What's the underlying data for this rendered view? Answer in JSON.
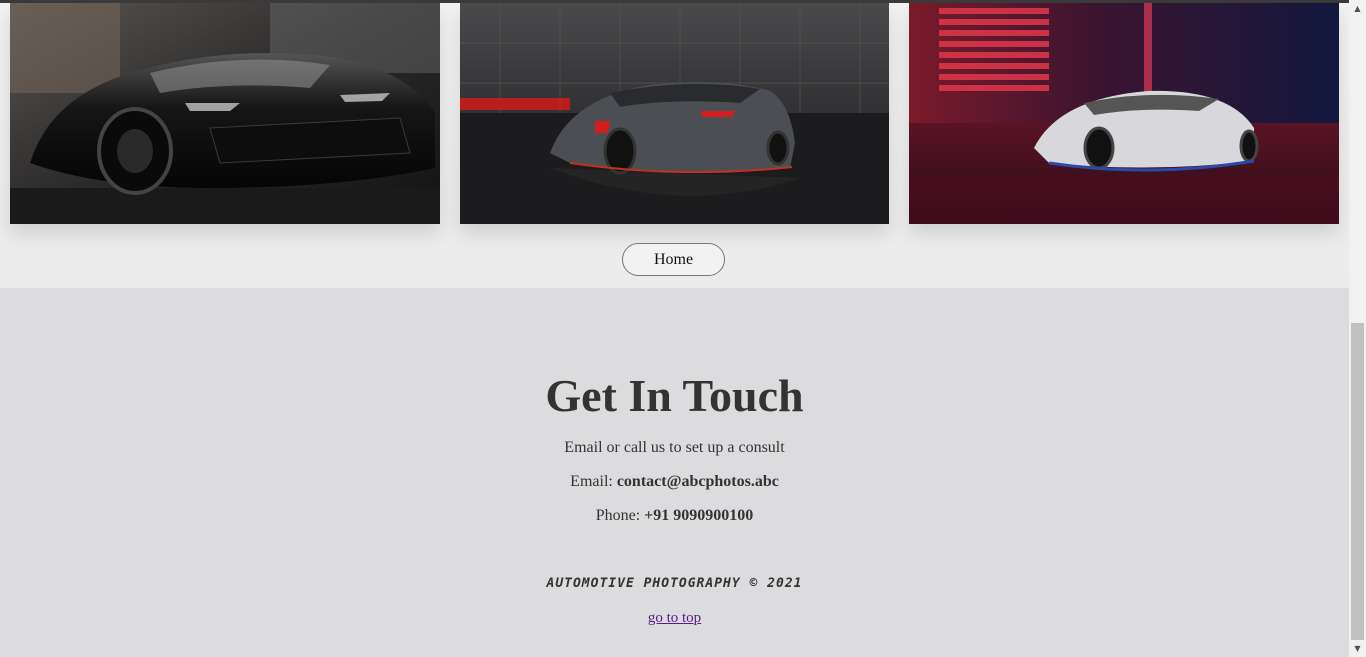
{
  "gallery": {
    "photos": [
      {
        "alt": "black-lamborghini-photo"
      },
      {
        "alt": "grey-red-lamborghini-photo"
      },
      {
        "alt": "white-lamborghini-photo"
      }
    ],
    "home_label": "Home"
  },
  "contact": {
    "title": "Get In Touch",
    "subtitle": "Email or call us to set up a consult",
    "email_label": "Email:",
    "email_value": "contact@abcphotos.abc",
    "phone_label": "Phone:",
    "phone_value": "+91 9090900100"
  },
  "footer": {
    "copyright": "AUTOMOTIVE PHOTOGRAPHY © 2021",
    "go_to_top": "go to top"
  },
  "colors": {
    "contact_bg": "#dcdcde",
    "gallery_bg": "#efefef",
    "text": "#333333",
    "link_visited": "#551a8b"
  }
}
